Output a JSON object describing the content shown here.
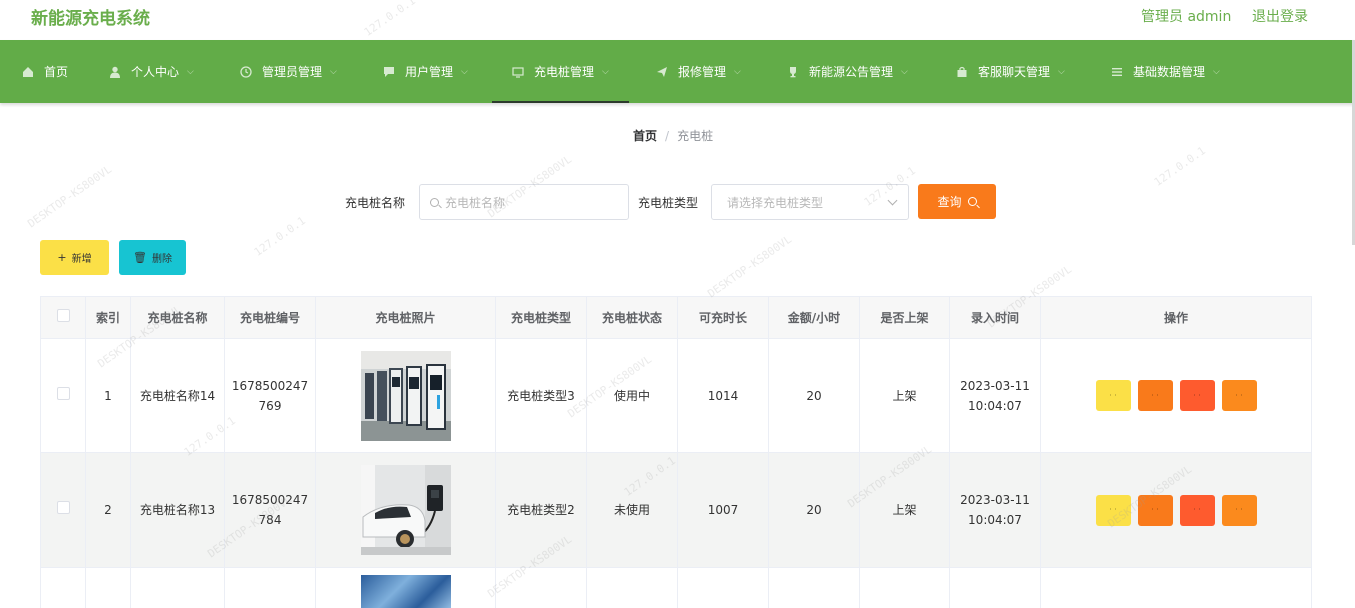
{
  "app": {
    "title": "新能源充电系统",
    "admin": "管理员 admin",
    "logout": "退出登录"
  },
  "nav": [
    {
      "label": "首页",
      "icon": "home-icon",
      "dropdown": false
    },
    {
      "label": "个人中心",
      "icon": "user-icon",
      "dropdown": true
    },
    {
      "label": "管理员管理",
      "icon": "clock-icon",
      "dropdown": true
    },
    {
      "label": "用户管理",
      "icon": "chat-icon",
      "dropdown": true
    },
    {
      "label": "充电桩管理",
      "icon": "screen-icon",
      "dropdown": true,
      "active": true
    },
    {
      "label": "报修管理",
      "icon": "send-icon",
      "dropdown": true
    },
    {
      "label": "新能源公告管理",
      "icon": "trophy-icon",
      "dropdown": true
    },
    {
      "label": "客服聊天管理",
      "icon": "bag-icon",
      "dropdown": true
    },
    {
      "label": "基础数据管理",
      "icon": "menu-icon",
      "dropdown": true
    }
  ],
  "breadcrumb": {
    "home": "首页",
    "separator": "/",
    "current": "充电桩"
  },
  "search": {
    "name_label": "充电桩名称",
    "name_placeholder": "充电桩名称",
    "type_label": "充电桩类型",
    "type_placeholder": "请选择充电桩类型",
    "query_button": "查询"
  },
  "actions": {
    "add": "新增",
    "delete": "删除"
  },
  "table": {
    "headers": [
      "索引",
      "充电桩名称",
      "充电桩编号",
      "充电桩照片",
      "充电桩类型",
      "充电桩状态",
      "可充时长",
      "金额/小时",
      "是否上架",
      "录入时间",
      "操作"
    ],
    "rows": [
      {
        "index": "1",
        "name": "充电桩名称14",
        "code": "1678500247769",
        "photo": "charging-station-row-photo",
        "type": "充电桩类型3",
        "status": "使用中",
        "duration": "1014",
        "price": "20",
        "shelf": "上架",
        "created": "2023-03-11 10:04:07"
      },
      {
        "index": "2",
        "name": "充电桩名称13",
        "code": "1678500247784",
        "photo": "car-charging-photo",
        "type": "充电桩类型2",
        "status": "未使用",
        "duration": "1007",
        "price": "20",
        "shelf": "上架",
        "created": "2023-03-11 10:04:07"
      }
    ]
  },
  "watermark": [
    "127.0.0.1",
    "DESKTOP-KS800VL"
  ],
  "colors": {
    "brand_green": "#62ac48",
    "title_green": "#6aae4c",
    "query_orange": "#f97a1b",
    "add_yellow": "#fbe047",
    "delete_cyan": "#17c4d2",
    "op_red": "#fe5b2e"
  }
}
